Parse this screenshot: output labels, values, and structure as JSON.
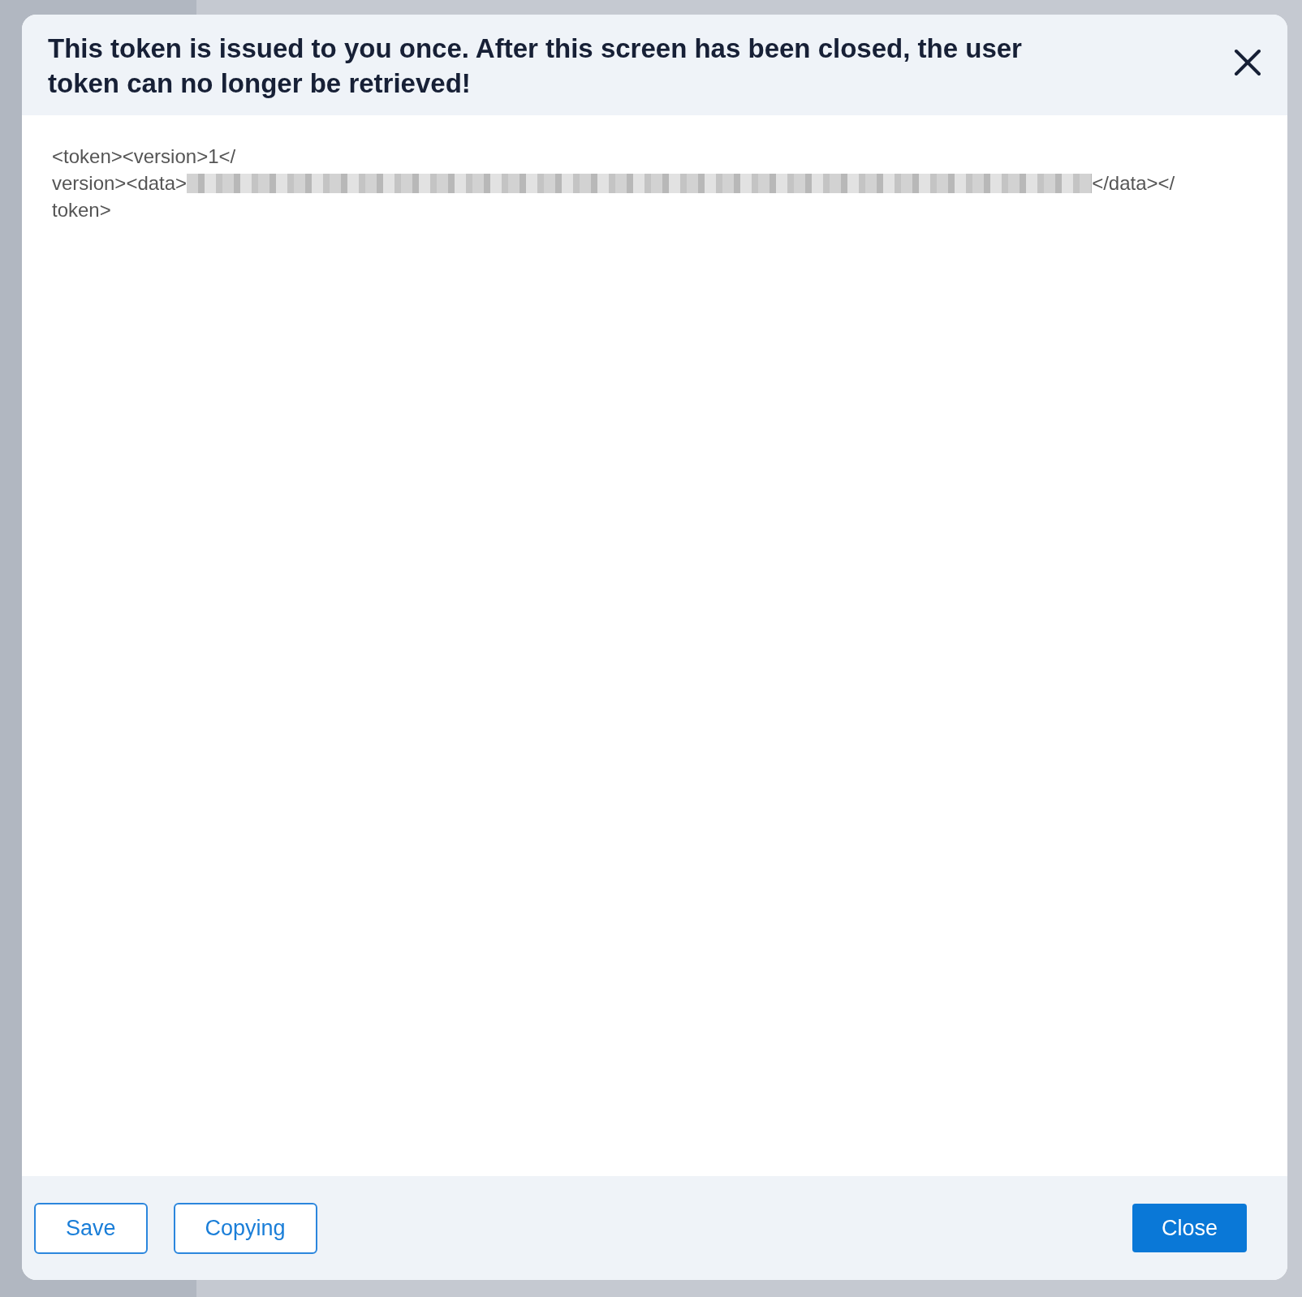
{
  "dialog": {
    "title": "This token is issued to you once. After this screen has been closed, the user token can no longer be retrieved!",
    "token_lines": [
      "<token><version>1</",
      "version><data>",
      "</data></",
      "token>"
    ],
    "buttons": [
      {
        "label": "Save",
        "kind": "outline"
      },
      {
        "label": "Copying",
        "kind": "outline"
      },
      {
        "label": "Close",
        "kind": "primary"
      }
    ]
  }
}
